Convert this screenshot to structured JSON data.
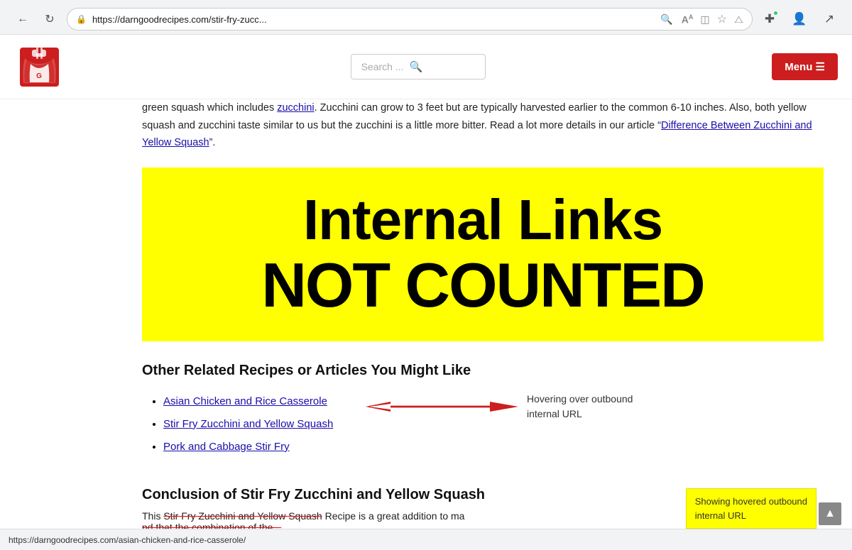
{
  "browser": {
    "url": "https://darngoodrecipes.com/stir-fry-zucc...",
    "back_title": "Back",
    "reload_title": "Reload",
    "search_icon": "🔍",
    "font_icon": "A",
    "translate_icon": "⊡",
    "star_icon": "☆",
    "split_icon": "⊏",
    "extension_icon": "⊕",
    "profile_icon": "👤",
    "share_icon": "↗"
  },
  "header": {
    "search_placeholder": "Search ...",
    "menu_label": "Menu ☰"
  },
  "intro": {
    "text_part1": "green squash which includes ",
    "zucchini_link": "zucchini",
    "text_part2": ". Zucchini can grow to 3 feet but are typically harvested earlier to the common 6-10 inches. Also, both yellow squash and zucchini taste similar to us but the zucchini is a little more bitter. Read a lot more details in our article “",
    "article_link": "Difference Between Zucchini and Yellow Squash",
    "text_part3": "”."
  },
  "banner": {
    "line1": "Internal Links",
    "line2": "NOT COUNTED"
  },
  "related": {
    "heading": "Other Related Recipes or Articles You Might Like",
    "items": [
      {
        "label": "Asian Chicken and Rice Casserole",
        "url": "#"
      },
      {
        "label": "Stir Fry Zucchini and Yellow Squash",
        "url": "#"
      },
      {
        "label": "Pork and Cabbage Stir Fry",
        "url": "#"
      }
    ],
    "annotation_text": "Hovering over outbound\ninternal URL"
  },
  "conclusion": {
    "heading": "Conclusion of Stir Fry Zucchini and Yellow Squash",
    "partial_text1": "This ",
    "partial_text2": "Stir Fry Zucchini and Yellow Squash",
    "partial_text3": " Recipe is a great addition to ma",
    "partial_text4": "nd that the combination of the..."
  },
  "status": {
    "url": "https://darngoodrecipes.com/asian-chicken-and-rice-casserole/",
    "tooltip_line1": "Showing hovered outbound",
    "tooltip_line2": "internal URL"
  },
  "scroll_top": "▲"
}
